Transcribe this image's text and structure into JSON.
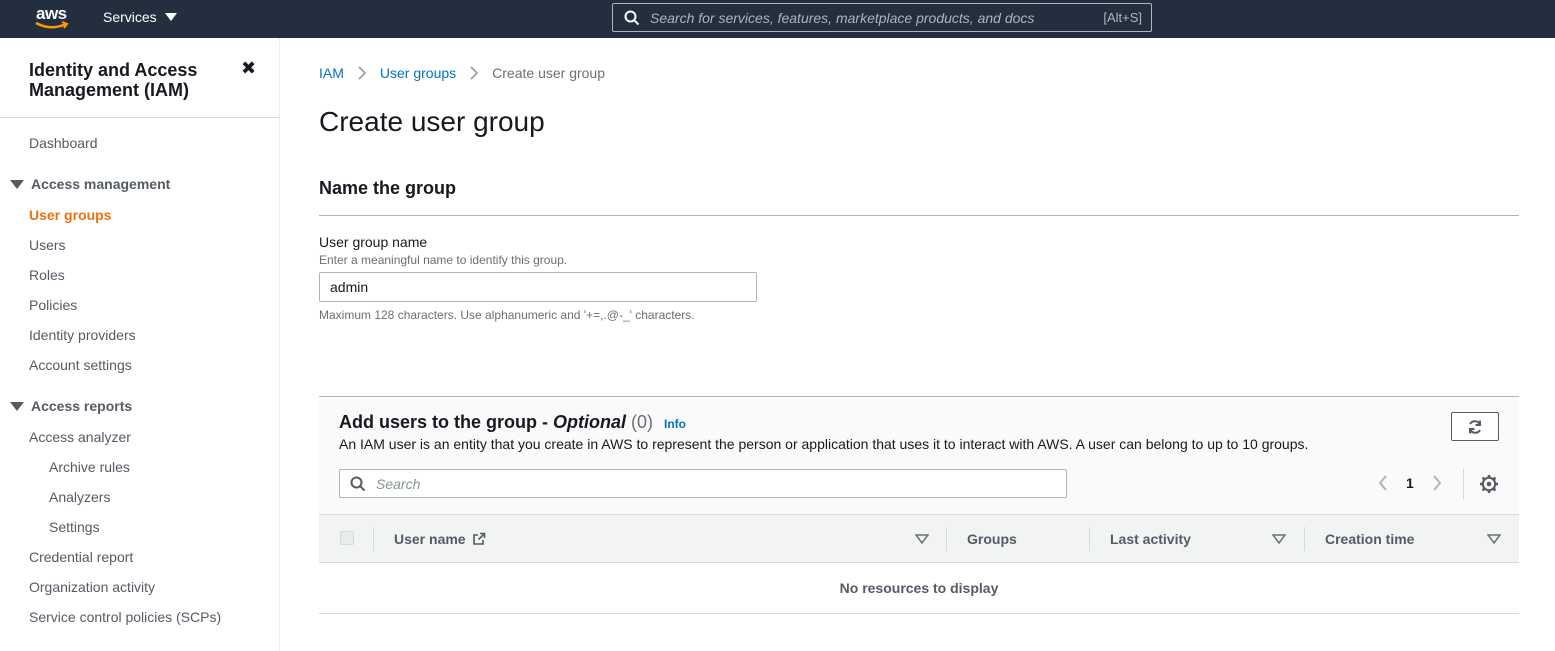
{
  "topbar": {
    "logo_text": "aws",
    "services_label": "Services",
    "search_placeholder": "Search for services, features, marketplace products, and docs",
    "search_shortcut": "[Alt+S]"
  },
  "sidebar": {
    "title": "Identity and Access Management (IAM)",
    "close_glyph": "✖",
    "dashboard": "Dashboard",
    "access_management": {
      "label": "Access management",
      "items": [
        "User groups",
        "Users",
        "Roles",
        "Policies",
        "Identity providers",
        "Account settings"
      ],
      "active": "User groups"
    },
    "access_reports": {
      "label": "Access reports",
      "items": [
        "Access analyzer",
        "Archive rules",
        "Analyzers",
        "Settings",
        "Credential report",
        "Organization activity",
        "Service control policies (SCPs)"
      ]
    }
  },
  "breadcrumb": {
    "items": [
      "IAM",
      "User groups"
    ],
    "current": "Create user group"
  },
  "page_title": "Create user group",
  "name_section": {
    "heading": "Name the group",
    "field_label": "User group name",
    "field_description": "Enter a meaningful name to identify this group.",
    "field_value": "admin",
    "field_constraint": "Maximum 128 characters. Use alphanumeric and '+=,.@-_' characters."
  },
  "users_section": {
    "title": "Add users to the group -",
    "title_optional": "Optional",
    "count": "(0)",
    "info_link": "Info",
    "description": "An IAM user is an entity that you create in AWS to represent the person or application that uses it to interact with AWS. A user can belong to up to 10 groups.",
    "search_placeholder": "Search",
    "page_number": "1",
    "columns": [
      "User name",
      "Groups",
      "Last activity",
      "Creation time"
    ],
    "empty_message": "No resources to display"
  },
  "colors": {
    "topbar_bg": "#232f3e",
    "link": "#0073bb",
    "active_nav": "#ec7211"
  }
}
